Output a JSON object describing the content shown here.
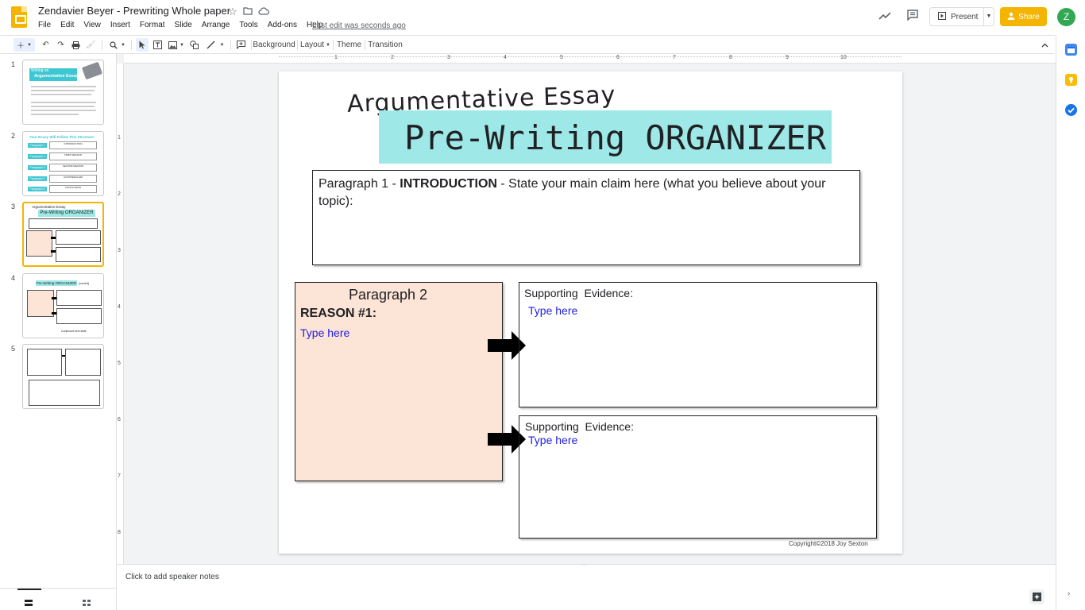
{
  "header": {
    "doc_title": "Zendavier Beyer - Prewriting Whole paper",
    "menu": [
      "File",
      "Edit",
      "View",
      "Insert",
      "Format",
      "Slide",
      "Arrange",
      "Tools",
      "Add-ons",
      "Help"
    ],
    "last_edit": "Last edit was seconds ago",
    "present_label": "Present",
    "share_label": "Share",
    "avatar_letter": "Z"
  },
  "toolbar": {
    "background_label": "Background",
    "layout_label": "Layout",
    "theme_label": "Theme",
    "transition_label": "Transition"
  },
  "filmstrip": {
    "slide_numbers": [
      "1",
      "2",
      "3",
      "4",
      "5"
    ],
    "selected_slide": 3,
    "thumb_texts": {
      "s1_title_a": "Writing an",
      "s1_title_b": "Argumentative Essay",
      "s2_title": "Your Essay Will Follow This Structure:",
      "s2_rows": [
        "Paragraph 1",
        "Paragraph 2",
        "Paragraph 3",
        "Paragraph 4",
        "Paragraph 5"
      ],
      "s2_boxes": [
        "INTRODUCTION",
        "FIRST REASON",
        "SECOND REASON",
        "COUNTERCLAIM",
        "CONCLUSION"
      ],
      "s3_title_a": "Argumentative Essay",
      "s3_title_b": "Pre-Writing ORGANIZER",
      "s4_title": "Pre-Writing ORGANIZER",
      "s4_suffix": "(cont'd)",
      "s4_footer": "Continued next slide"
    }
  },
  "ruler": {
    "h_numbers": [
      "1",
      "2",
      "3",
      "4",
      "5",
      "6",
      "7",
      "8",
      "9",
      "10"
    ],
    "v_numbers": [
      "1",
      "2",
      "3",
      "4",
      "5",
      "6",
      "7",
      "8"
    ]
  },
  "slide": {
    "title_small": "Argumentative Essay",
    "title_banner": "Pre-Writing ORGANIZER",
    "banner_color": "#9ee9e8",
    "intro_prefix": "Paragraph 1 - ",
    "intro_bold": "INTRODUCTION",
    "intro_rest": "  -  State your main claim here (what you believe about your topic):",
    "para2_title": "Paragraph 2",
    "reason_label": "REASON #1:",
    "para2_fill": "#fce4d6",
    "type_here": "Type here",
    "evidence_label": "Supporting  Evidence:",
    "copyright": "Copyright©2018 Joy Sexton"
  },
  "notes": {
    "placeholder": "Click to add speaker notes"
  }
}
